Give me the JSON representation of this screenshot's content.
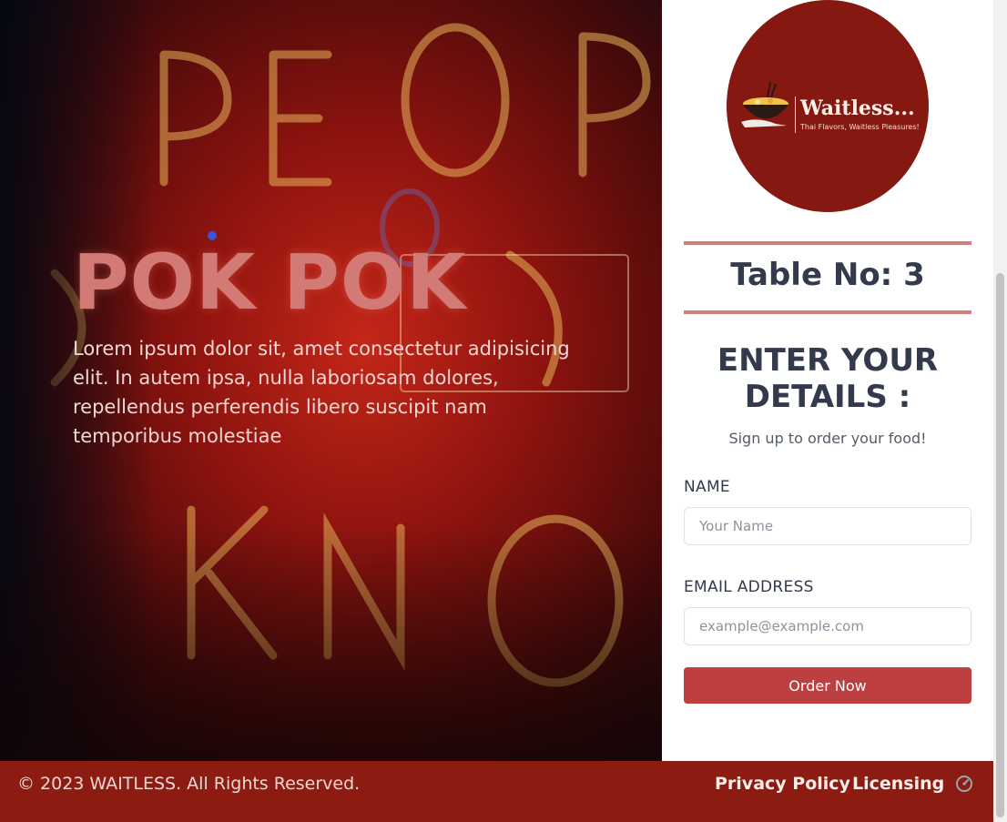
{
  "hero": {
    "title": "POK POK",
    "description": "Lorem ipsum dolor sit, amet consectetur adipisicing elit. In autem ipsa, nulla laboriosam dolores, repellendus perferendis libero suscipit nam temporibus molestiae"
  },
  "logo": {
    "name": "Waitless...",
    "tagline": "Thai Flavors, Waitless Pleasures!"
  },
  "signup": {
    "table_label": "Table No: 3",
    "heading": "ENTER YOUR DETAILS :",
    "subtitle": "Sign up to order your food!",
    "name_label": "NAME",
    "name_placeholder": "Your Name",
    "email_label": "EMAIL ADDRESS",
    "email_placeholder": "example@example.com",
    "submit_label": "Order Now"
  },
  "footer": {
    "copyright": "© 2023 WAITLESS. All Rights Reserved.",
    "links": [
      "Privacy Policy",
      "Licensing"
    ],
    "icon": "theme-toggle-icon"
  },
  "colors": {
    "brand_red": "#8c1b12",
    "button_red": "#bd3f40",
    "title_pink": "#d27b76",
    "heading_dark": "#323a4b"
  }
}
